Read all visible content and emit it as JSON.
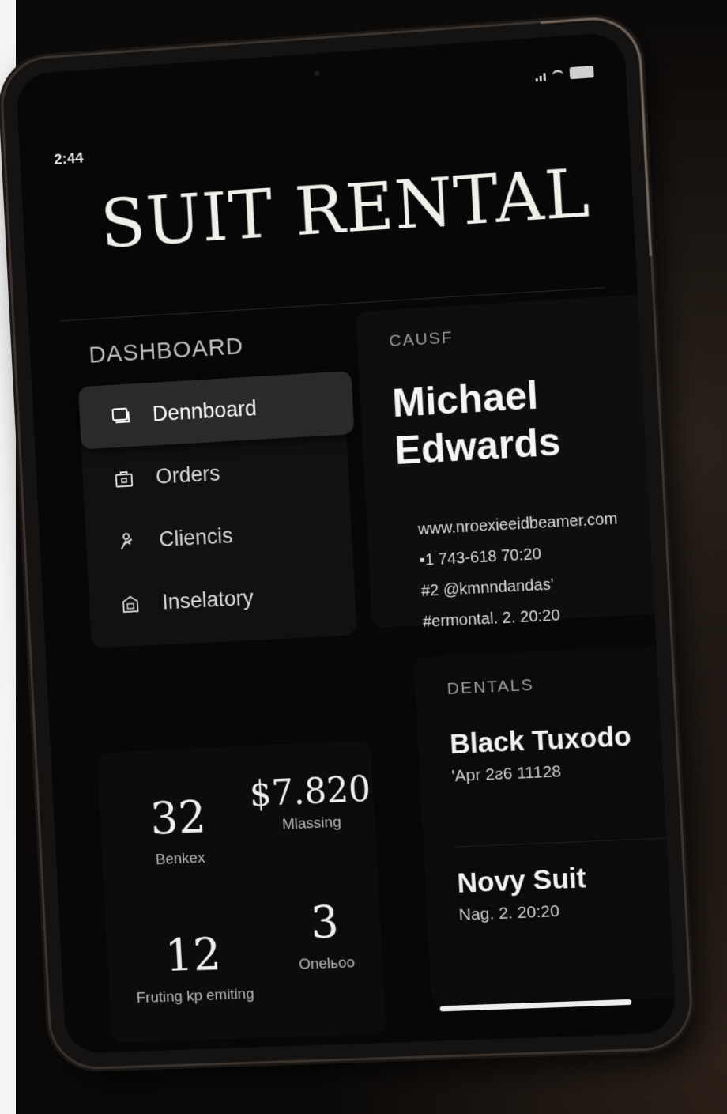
{
  "status_bar": {
    "time": "2:44"
  },
  "app": {
    "title": "SUIT RENTAL"
  },
  "sidebar": {
    "heading": "DASHBOARD",
    "items": [
      {
        "label": "Dennboard",
        "icon": "dashboard-icon",
        "active": true
      },
      {
        "label": "Orders",
        "icon": "orders-icon",
        "active": false
      },
      {
        "label": "Cliencis",
        "icon": "clients-icon",
        "active": false
      },
      {
        "label": "Inselatory",
        "icon": "inventory-icon",
        "active": false
      }
    ]
  },
  "stats": [
    {
      "value": "32",
      "label": "Benkex"
    },
    {
      "value": "$7.820",
      "label": "Mlassing"
    },
    {
      "value": "12",
      "label": "Fruting kp emiting"
    },
    {
      "value": "3",
      "label": "Onelьoo"
    }
  ],
  "customer": {
    "section_label": "CAUSF",
    "name": "Michael Edwards",
    "website": "www.nroexieeidbeamer.com",
    "phone": "▪1 743-618  70:20",
    "handle": "#2 @kmnndandas'",
    "rental_date": "#ermontal. 2. 20:20"
  },
  "rentals": {
    "section_label": "DENTALS",
    "items": [
      {
        "name": "Black Tuxodo",
        "date": "'Apr 2ƨ6  11128"
      },
      {
        "name": "Novy Suit",
        "date": "Nag. 2. 20:20"
      }
    ]
  },
  "colors": {
    "background": "#070707",
    "text_primary": "#f1efea",
    "nav_active": "#2a2a2a"
  }
}
